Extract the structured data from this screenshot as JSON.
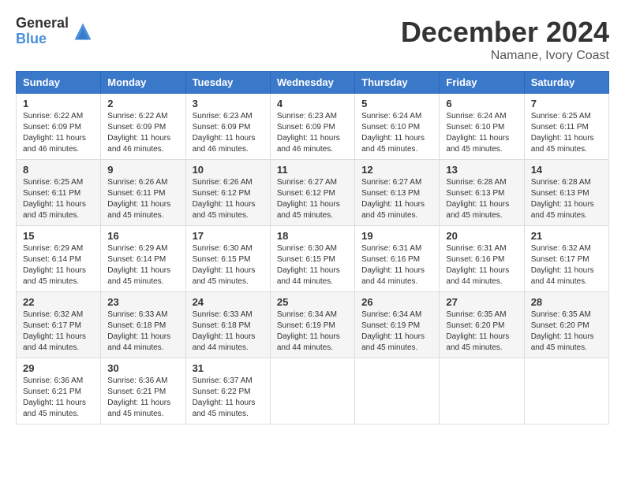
{
  "header": {
    "logo_general": "General",
    "logo_blue": "Blue",
    "title": "December 2024",
    "location": "Namane, Ivory Coast"
  },
  "days_of_week": [
    "Sunday",
    "Monday",
    "Tuesday",
    "Wednesday",
    "Thursday",
    "Friday",
    "Saturday"
  ],
  "weeks": [
    [
      {
        "day": "1",
        "lines": [
          "Sunrise: 6:22 AM",
          "Sunset: 6:09 PM",
          "Daylight: 11 hours",
          "and 46 minutes."
        ]
      },
      {
        "day": "2",
        "lines": [
          "Sunrise: 6:22 AM",
          "Sunset: 6:09 PM",
          "Daylight: 11 hours",
          "and 46 minutes."
        ]
      },
      {
        "day": "3",
        "lines": [
          "Sunrise: 6:23 AM",
          "Sunset: 6:09 PM",
          "Daylight: 11 hours",
          "and 46 minutes."
        ]
      },
      {
        "day": "4",
        "lines": [
          "Sunrise: 6:23 AM",
          "Sunset: 6:09 PM",
          "Daylight: 11 hours",
          "and 46 minutes."
        ]
      },
      {
        "day": "5",
        "lines": [
          "Sunrise: 6:24 AM",
          "Sunset: 6:10 PM",
          "Daylight: 11 hours",
          "and 45 minutes."
        ]
      },
      {
        "day": "6",
        "lines": [
          "Sunrise: 6:24 AM",
          "Sunset: 6:10 PM",
          "Daylight: 11 hours",
          "and 45 minutes."
        ]
      },
      {
        "day": "7",
        "lines": [
          "Sunrise: 6:25 AM",
          "Sunset: 6:11 PM",
          "Daylight: 11 hours",
          "and 45 minutes."
        ]
      }
    ],
    [
      {
        "day": "8",
        "lines": [
          "Sunrise: 6:25 AM",
          "Sunset: 6:11 PM",
          "Daylight: 11 hours",
          "and 45 minutes."
        ]
      },
      {
        "day": "9",
        "lines": [
          "Sunrise: 6:26 AM",
          "Sunset: 6:11 PM",
          "Daylight: 11 hours",
          "and 45 minutes."
        ]
      },
      {
        "day": "10",
        "lines": [
          "Sunrise: 6:26 AM",
          "Sunset: 6:12 PM",
          "Daylight: 11 hours",
          "and 45 minutes."
        ]
      },
      {
        "day": "11",
        "lines": [
          "Sunrise: 6:27 AM",
          "Sunset: 6:12 PM",
          "Daylight: 11 hours",
          "and 45 minutes."
        ]
      },
      {
        "day": "12",
        "lines": [
          "Sunrise: 6:27 AM",
          "Sunset: 6:13 PM",
          "Daylight: 11 hours",
          "and 45 minutes."
        ]
      },
      {
        "day": "13",
        "lines": [
          "Sunrise: 6:28 AM",
          "Sunset: 6:13 PM",
          "Daylight: 11 hours",
          "and 45 minutes."
        ]
      },
      {
        "day": "14",
        "lines": [
          "Sunrise: 6:28 AM",
          "Sunset: 6:13 PM",
          "Daylight: 11 hours",
          "and 45 minutes."
        ]
      }
    ],
    [
      {
        "day": "15",
        "lines": [
          "Sunrise: 6:29 AM",
          "Sunset: 6:14 PM",
          "Daylight: 11 hours",
          "and 45 minutes."
        ]
      },
      {
        "day": "16",
        "lines": [
          "Sunrise: 6:29 AM",
          "Sunset: 6:14 PM",
          "Daylight: 11 hours",
          "and 45 minutes."
        ]
      },
      {
        "day": "17",
        "lines": [
          "Sunrise: 6:30 AM",
          "Sunset: 6:15 PM",
          "Daylight: 11 hours",
          "and 45 minutes."
        ]
      },
      {
        "day": "18",
        "lines": [
          "Sunrise: 6:30 AM",
          "Sunset: 6:15 PM",
          "Daylight: 11 hours",
          "and 44 minutes."
        ]
      },
      {
        "day": "19",
        "lines": [
          "Sunrise: 6:31 AM",
          "Sunset: 6:16 PM",
          "Daylight: 11 hours",
          "and 44 minutes."
        ]
      },
      {
        "day": "20",
        "lines": [
          "Sunrise: 6:31 AM",
          "Sunset: 6:16 PM",
          "Daylight: 11 hours",
          "and 44 minutes."
        ]
      },
      {
        "day": "21",
        "lines": [
          "Sunrise: 6:32 AM",
          "Sunset: 6:17 PM",
          "Daylight: 11 hours",
          "and 44 minutes."
        ]
      }
    ],
    [
      {
        "day": "22",
        "lines": [
          "Sunrise: 6:32 AM",
          "Sunset: 6:17 PM",
          "Daylight: 11 hours",
          "and 44 minutes."
        ]
      },
      {
        "day": "23",
        "lines": [
          "Sunrise: 6:33 AM",
          "Sunset: 6:18 PM",
          "Daylight: 11 hours",
          "and 44 minutes."
        ]
      },
      {
        "day": "24",
        "lines": [
          "Sunrise: 6:33 AM",
          "Sunset: 6:18 PM",
          "Daylight: 11 hours",
          "and 44 minutes."
        ]
      },
      {
        "day": "25",
        "lines": [
          "Sunrise: 6:34 AM",
          "Sunset: 6:19 PM",
          "Daylight: 11 hours",
          "and 44 minutes."
        ]
      },
      {
        "day": "26",
        "lines": [
          "Sunrise: 6:34 AM",
          "Sunset: 6:19 PM",
          "Daylight: 11 hours",
          "and 45 minutes."
        ]
      },
      {
        "day": "27",
        "lines": [
          "Sunrise: 6:35 AM",
          "Sunset: 6:20 PM",
          "Daylight: 11 hours",
          "and 45 minutes."
        ]
      },
      {
        "day": "28",
        "lines": [
          "Sunrise: 6:35 AM",
          "Sunset: 6:20 PM",
          "Daylight: 11 hours",
          "and 45 minutes."
        ]
      }
    ],
    [
      {
        "day": "29",
        "lines": [
          "Sunrise: 6:36 AM",
          "Sunset: 6:21 PM",
          "Daylight: 11 hours",
          "and 45 minutes."
        ]
      },
      {
        "day": "30",
        "lines": [
          "Sunrise: 6:36 AM",
          "Sunset: 6:21 PM",
          "Daylight: 11 hours",
          "and 45 minutes."
        ]
      },
      {
        "day": "31",
        "lines": [
          "Sunrise: 6:37 AM",
          "Sunset: 6:22 PM",
          "Daylight: 11 hours",
          "and 45 minutes."
        ]
      },
      null,
      null,
      null,
      null
    ]
  ]
}
